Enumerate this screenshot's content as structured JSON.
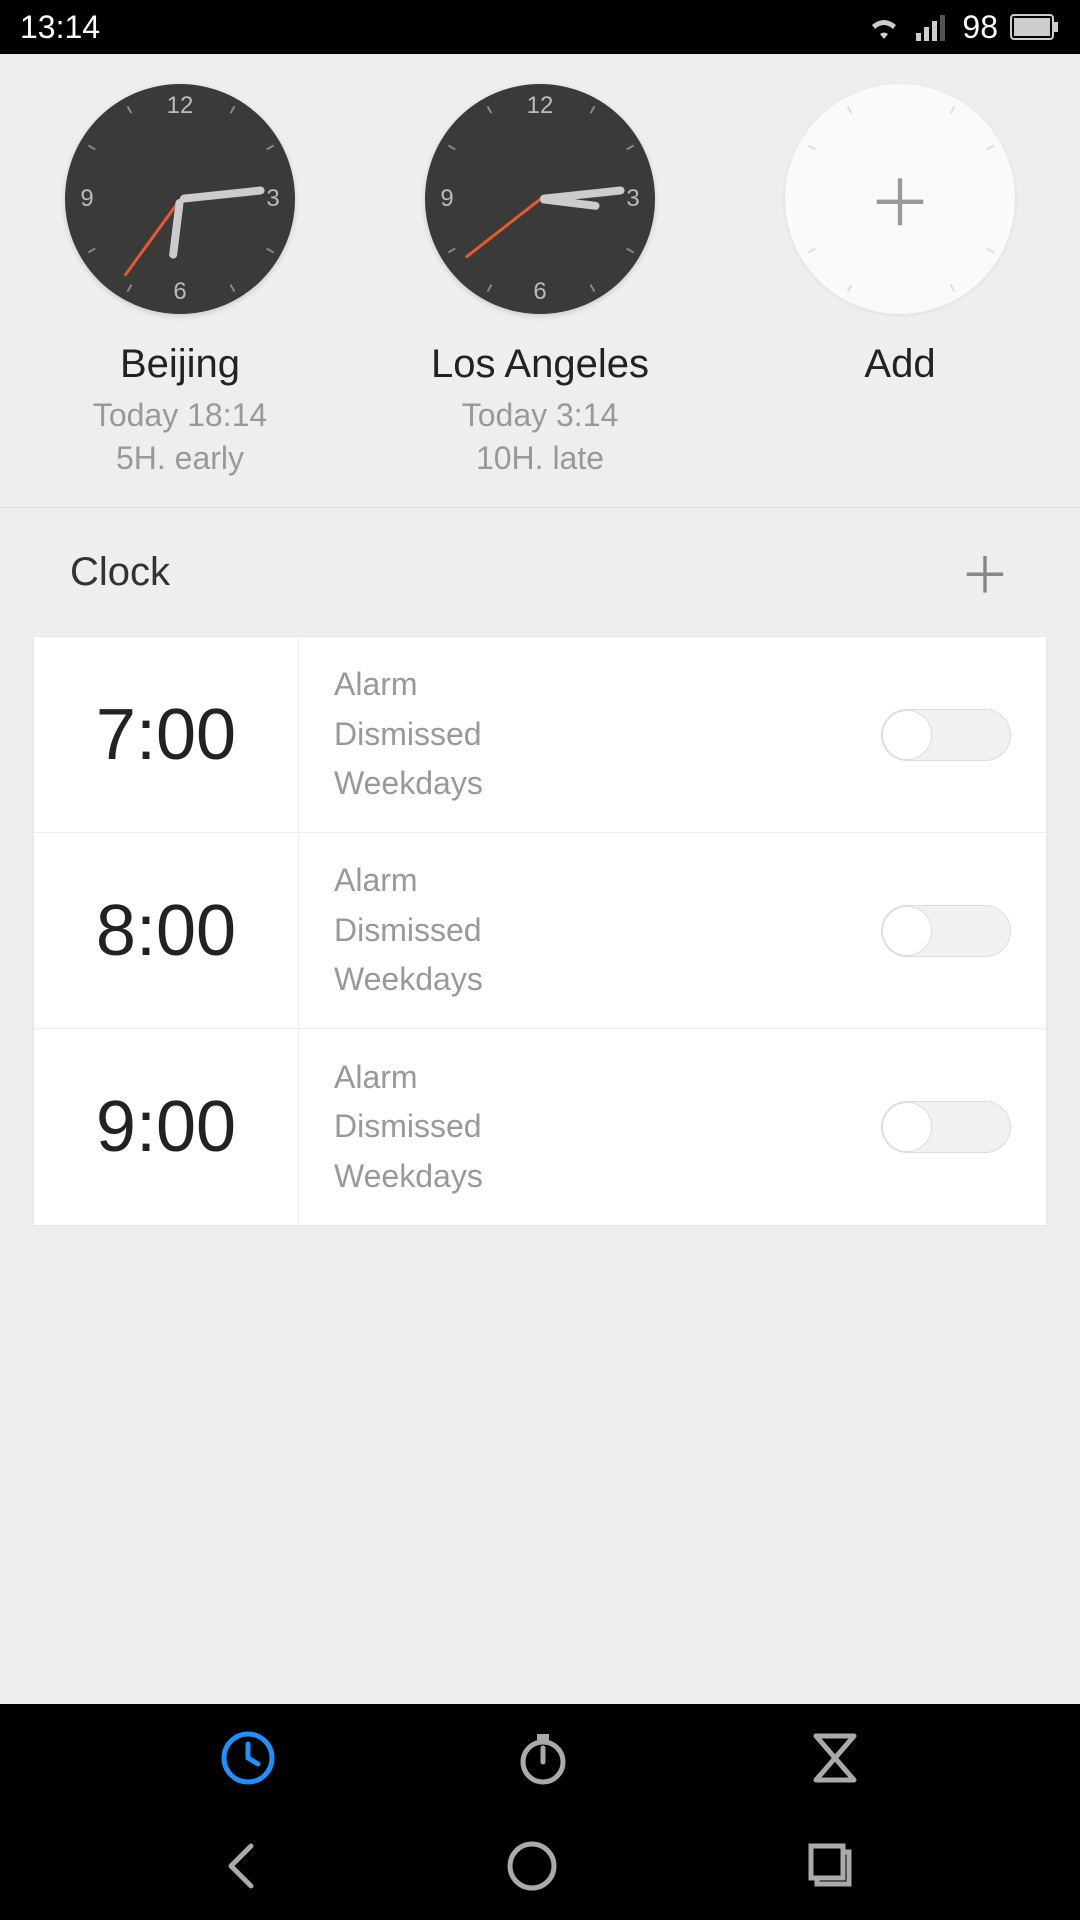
{
  "status": {
    "time": "13:14",
    "battery": "98"
  },
  "world_clocks": [
    {
      "city": "Beijing",
      "time": "Today 18:14",
      "offset": "5H. early",
      "hour_angle": 187,
      "min_angle": 84,
      "sec_angle": 216
    },
    {
      "city": "Los Angeles",
      "time": "Today 3:14",
      "offset": "10H. late",
      "hour_angle": 97,
      "min_angle": 84,
      "sec_angle": 232
    }
  ],
  "add_clock_label": "Add",
  "section_title": "Clock",
  "alarms": [
    {
      "time": "7:00",
      "label": "Alarm",
      "status": "Dismissed",
      "repeat": "Weekdays",
      "enabled": false
    },
    {
      "time": "8:00",
      "label": "Alarm",
      "status": "Dismissed",
      "repeat": "Weekdays",
      "enabled": false
    },
    {
      "time": "9:00",
      "label": "Alarm",
      "status": "Dismissed",
      "repeat": "Weekdays",
      "enabled": false
    }
  ]
}
